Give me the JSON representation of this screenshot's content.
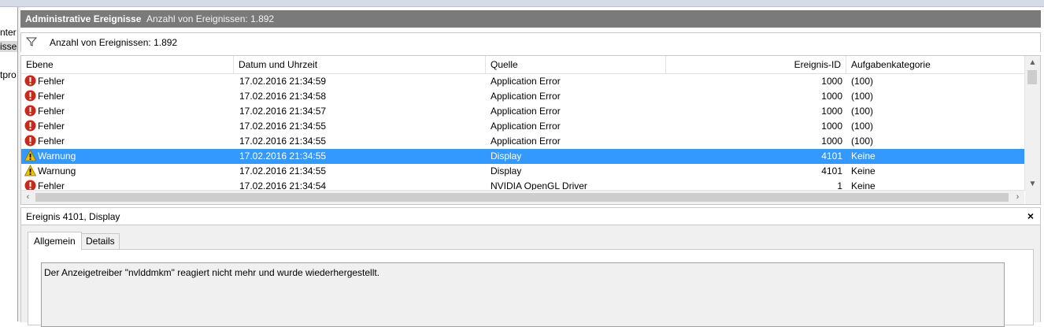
{
  "left_tree": {
    "fragments": [
      "nter",
      "isse",
      "tpro"
    ]
  },
  "title_bar": {
    "title": "Administrative Ereignisse",
    "subtitle": "Anzahl von Ereignissen: 1.892"
  },
  "filter_bar": {
    "icon": "funnel-filter-icon",
    "text": "Anzahl von Ereignissen: 1.892"
  },
  "table": {
    "columns": [
      "Ebene",
      "Datum und Uhrzeit",
      "Quelle",
      "Ereignis-ID",
      "Aufgabenkategorie"
    ],
    "rows": [
      {
        "level": "Fehler",
        "icon": "error-icon",
        "date": "17.02.2016 21:34:59",
        "source": "Application Error",
        "id": "1000",
        "category": "(100)",
        "selected": false
      },
      {
        "level": "Fehler",
        "icon": "error-icon",
        "date": "17.02.2016 21:34:58",
        "source": "Application Error",
        "id": "1000",
        "category": "(100)",
        "selected": false
      },
      {
        "level": "Fehler",
        "icon": "error-icon",
        "date": "17.02.2016 21:34:57",
        "source": "Application Error",
        "id": "1000",
        "category": "(100)",
        "selected": false
      },
      {
        "level": "Fehler",
        "icon": "error-icon",
        "date": "17.02.2016 21:34:55",
        "source": "Application Error",
        "id": "1000",
        "category": "(100)",
        "selected": false
      },
      {
        "level": "Fehler",
        "icon": "error-icon",
        "date": "17.02.2016 21:34:55",
        "source": "Application Error",
        "id": "1000",
        "category": "(100)",
        "selected": false
      },
      {
        "level": "Warnung",
        "icon": "warning-icon",
        "date": "17.02.2016 21:34:55",
        "source": "Display",
        "id": "4101",
        "category": "Keine",
        "selected": true
      },
      {
        "level": "Warnung",
        "icon": "warning-icon",
        "date": "17.02.2016 21:34:55",
        "source": "Display",
        "id": "4101",
        "category": "Keine",
        "selected": false
      },
      {
        "level": "Fehler",
        "icon": "error-icon",
        "date": "17.02.2016 21:34:54",
        "source": "NVIDIA OpenGL Driver",
        "id": "1",
        "category": "Keine",
        "selected": false
      }
    ]
  },
  "detail": {
    "title": "Ereignis 4101, Display",
    "close_label": "×",
    "tabs": [
      "Allgemein",
      "Details"
    ],
    "active_tab": "Allgemein",
    "message": "Der Anzeigetreiber \"nvlddmkm\" reagiert nicht mehr und wurde wiederhergestellt."
  },
  "colors": {
    "selection": "#3399ff",
    "title_bar": "#7a7a7a",
    "error": "#c42b1c",
    "warning": "#f2c200"
  }
}
